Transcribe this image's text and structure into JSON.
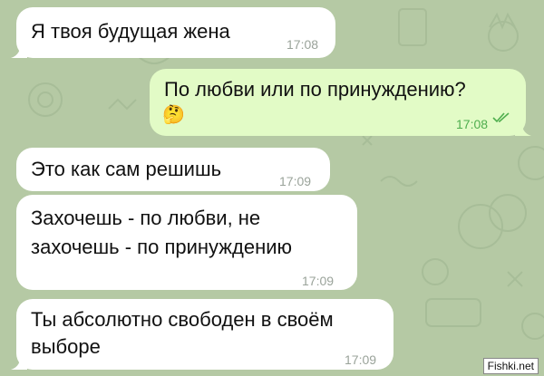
{
  "messages": [
    {
      "text": "Я твоя будущая жена",
      "time": "17:08"
    },
    {
      "text": "По любви или по принуждению?",
      "emoji": "🤔",
      "time": "17:08"
    },
    {
      "text": "Это как сам решишь",
      "time": "17:09"
    },
    {
      "lines": [
        "Захочешь - по любви, не",
        "захочешь - по принуждению"
      ],
      "time": "17:09"
    },
    {
      "lines": [
        "Ты абсолютно свободен в своём",
        "выборе"
      ],
      "time": "17:09"
    }
  ],
  "watermark": "Fishki.net",
  "colors": {
    "background": "#b5c9a4",
    "incoming_bubble": "#ffffff",
    "outgoing_bubble": "#e2fbc6",
    "outgoing_time": "#4fae4e"
  },
  "icons": {
    "read_receipt": "double-check-icon",
    "bubble_tail": "bubble-tail-icon"
  }
}
